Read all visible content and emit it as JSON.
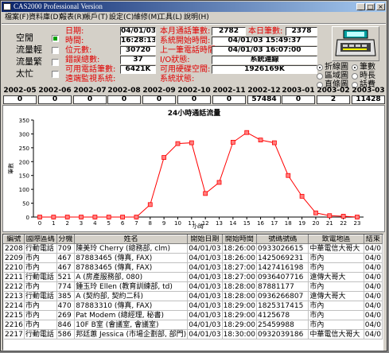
{
  "window": {
    "title": "CAS2000 Professional Version"
  },
  "menu": [
    "檔案(F)",
    "資料庫(D)",
    "報表(R)",
    "帳戶(T)",
    "設定(C)",
    "維修(M)",
    "工具(L)",
    "說明(H)"
  ],
  "status_lights": [
    {
      "label": "空閒",
      "checked": true
    },
    {
      "label": "流量輕",
      "checked": false
    },
    {
      "label": "流量繁",
      "checked": false
    },
    {
      "label": "太忙",
      "checked": false
    }
  ],
  "info": {
    "date_label": "日期:",
    "date_value": "04/01/03",
    "time_label": "時間:",
    "time_value": "16:28:13",
    "bytes_label": "位元數:",
    "bytes_value": "30720",
    "errors_label": "錯誤總數:",
    "errors_value": "37",
    "memory_label": "可用電話筆數:",
    "memory_value": "6421K",
    "noconn_label": "遠端監視系統:",
    "month_calls_label": "本月通話筆數:",
    "month_calls_value": "2782",
    "today_label": "本日筆數:",
    "today_value": "2378",
    "start_label": "系統開始時間:",
    "start_value": "04/01/03 15:49:37",
    "last_label": "上一筆電話時間:",
    "last_value": "04/01/03 16:07:00",
    "io_label": "I/O狀態:",
    "io_value": "系統連線",
    "disk_label": "可用硬碟空間:",
    "disk_value": "1926169K",
    "sys_label": "系統狀態:",
    "sys_value": ""
  },
  "options_left": [
    {
      "label": "折線圖",
      "selected": true
    },
    {
      "label": "區域圖",
      "selected": false
    },
    {
      "label": "直條圖",
      "selected": false
    }
  ],
  "options_right": [
    {
      "label": "筆數",
      "selected": true
    },
    {
      "label": "時長",
      "selected": false
    },
    {
      "label": "話費",
      "selected": false
    }
  ],
  "months": [
    {
      "month": "2002-05",
      "value": "0"
    },
    {
      "month": "2002-06",
      "value": "0"
    },
    {
      "month": "2002-07",
      "value": "0"
    },
    {
      "month": "2002-08",
      "value": "0"
    },
    {
      "month": "2002-09",
      "value": "0"
    },
    {
      "month": "2002-10",
      "value": "0"
    },
    {
      "month": "2002-11",
      "value": "0"
    },
    {
      "month": "2002-12",
      "value": "57484"
    },
    {
      "month": "2003-01",
      "value": "0"
    },
    {
      "month": "2003-02",
      "value": "2"
    },
    {
      "month": "2003-03",
      "value": "11428"
    }
  ],
  "chart_data": {
    "type": "line",
    "title": "24小時通話流量",
    "xlabel": "小時",
    "ylabel": "筆數",
    "x": [
      0,
      1,
      2,
      3,
      4,
      5,
      6,
      7,
      8,
      9,
      10,
      11,
      12,
      13,
      14,
      15,
      16,
      17,
      18,
      19,
      20,
      21,
      22,
      23
    ],
    "values": [
      0,
      0,
      0,
      0,
      0,
      0,
      0,
      0,
      45,
      215,
      265,
      268,
      85,
      125,
      270,
      305,
      278,
      268,
      150,
      75,
      15,
      5,
      3,
      0
    ],
    "ylim": [
      0,
      350
    ],
    "yticks": [
      0,
      50,
      100,
      150,
      200,
      250,
      300,
      350
    ],
    "color": "#ff0000"
  },
  "table": {
    "columns": [
      "編號",
      "國際區碼",
      "分機",
      "姓名",
      "開始日期",
      "開始時間",
      "號碼號碼",
      "致電地區",
      "結束"
    ],
    "rows": [
      [
        "2208",
        "行動電話",
        "709",
        "陳美玲 Cherry (總務部, clm)",
        "04/01/03",
        "18:26:00",
        "0933026615",
        "中華電信大哥大",
        "04/0"
      ],
      [
        "2209",
        "市內",
        "467",
        "87883465 (傳真, FAX)",
        "04/01/03",
        "18:26:00",
        "1425069231",
        "市內",
        "04/0"
      ],
      [
        "2210",
        "市內",
        "467",
        "87883465 (傳真, FAX)",
        "04/01/03",
        "18:27:00",
        "1427416198",
        "市內",
        "04/0"
      ],
      [
        "2211",
        "行動電話",
        "521",
        "A (房產服務部, 080)",
        "04/01/03",
        "18:27:00",
        "0936407716",
        "遠傳大哥大",
        "04/0"
      ],
      [
        "2212",
        "市內",
        "774",
        "鍾玉玲 Ellen (教育訓練部, td)",
        "04/01/03",
        "18:28:00",
        "87881177",
        "市內",
        "04/0"
      ],
      [
        "2213",
        "行動電話",
        "385",
        "A (契約部, 契約二科)",
        "04/01/03",
        "18:28:00",
        "0936266807",
        "遠傳大哥大",
        "04/0"
      ],
      [
        "2214",
        "市內",
        "470",
        "87883310 (傳真, FAX)",
        "04/01/03",
        "18:29:00",
        "1825317415",
        "市內",
        "04/0"
      ],
      [
        "2215",
        "市內",
        "269",
        "Pat Modem (總經理, 秘書)",
        "04/01/03",
        "18:29:00",
        "4125678",
        "市內",
        "04/0"
      ],
      [
        "2216",
        "市內",
        "846",
        "10F B室 (會議室, 會議室)",
        "04/01/03",
        "18:29:00",
        "25459988",
        "市內",
        "04/0"
      ],
      [
        "2217",
        "行動電話",
        "586",
        "邦廷蕙 Jessica (市場企劃部, 部門)",
        "04/01/03",
        "18:30:00",
        "0932039186",
        "中華電信大哥大",
        "04/0"
      ]
    ]
  }
}
